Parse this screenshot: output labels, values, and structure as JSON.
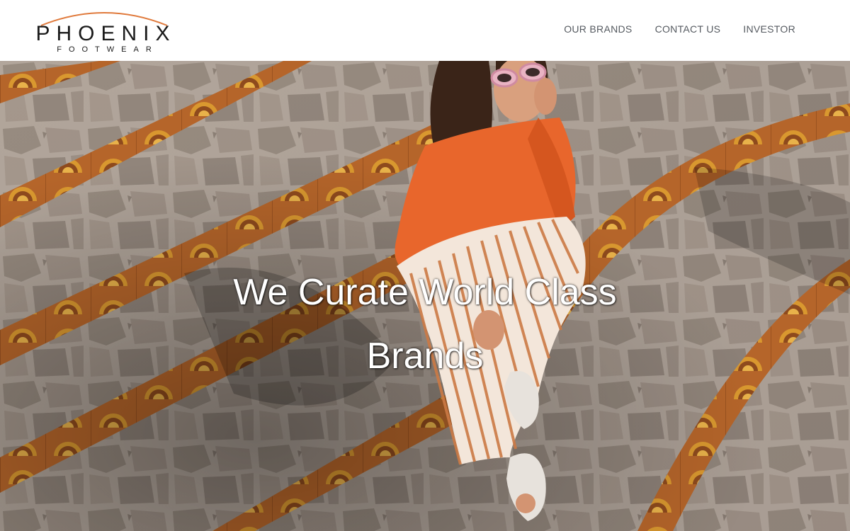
{
  "brand": {
    "name": "PHOENIX",
    "tagline": "FOOTWEAR",
    "arc_color": "#e07a3c",
    "text_color": "#1b1b1b"
  },
  "nav": {
    "items": [
      {
        "label": "OUR BRANDS"
      },
      {
        "label": "CONTACT US"
      },
      {
        "label": "INVESTOR"
      }
    ]
  },
  "hero": {
    "headline": "We Curate World Class Brands",
    "photo_description_icon": "hero-photo",
    "colors": {
      "sweater": "#e8662c",
      "tile": "#b8672a",
      "stone": "#9c9088"
    }
  }
}
